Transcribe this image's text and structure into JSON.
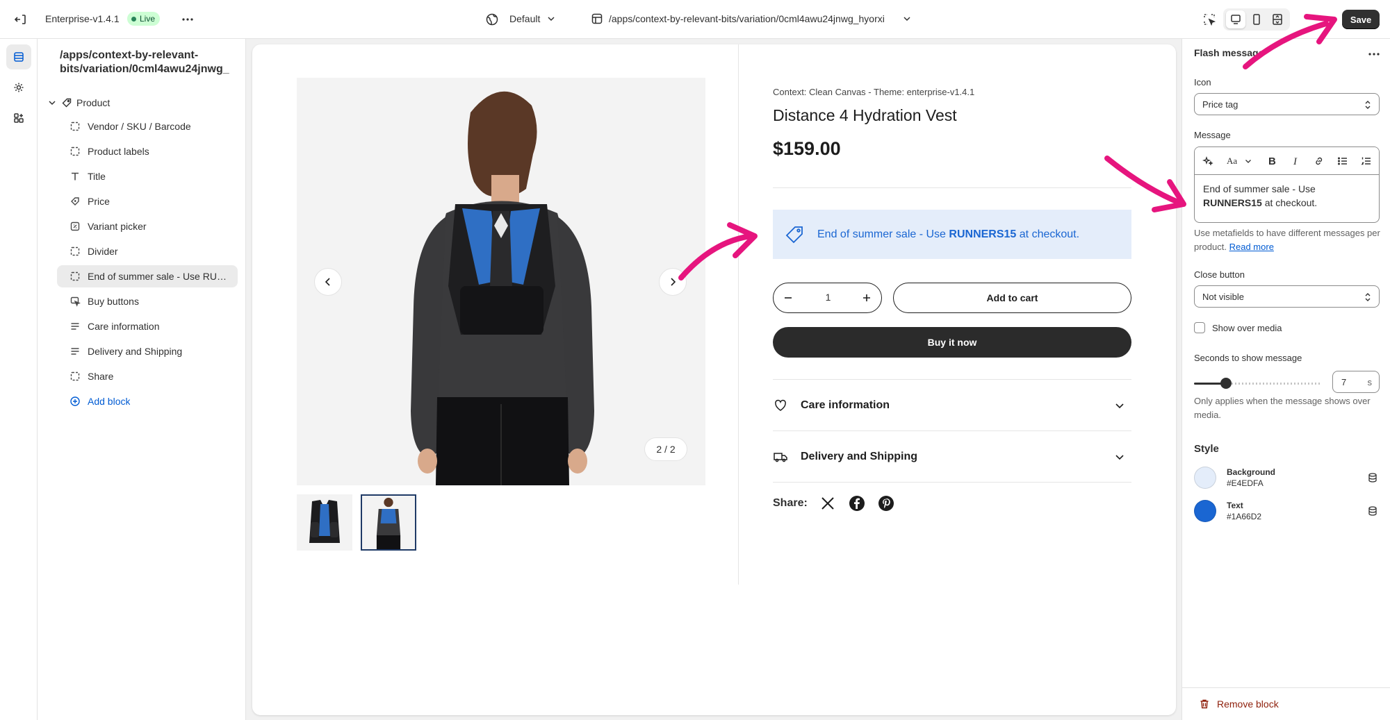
{
  "topbar": {
    "theme_name": "Enterprise-v1.4.1",
    "status_badge": "Live",
    "template": "Default",
    "page_path": "/apps/context-by-relevant-bits/variation/0cml4awu24jnwg_hyorxi",
    "save_label": "Save"
  },
  "sidebar": {
    "title_line1": "/apps/context-by-relevant-",
    "title_line2": "bits/variation/0cml4awu24jnwg_",
    "root_label": "Product",
    "items": [
      {
        "label": "Vendor / SKU / Barcode",
        "icon": "block-icon"
      },
      {
        "label": "Product labels",
        "icon": "block-icon"
      },
      {
        "label": "Title",
        "icon": "title-icon"
      },
      {
        "label": "Price",
        "icon": "price-icon"
      },
      {
        "label": "Variant picker",
        "icon": "variant-icon"
      },
      {
        "label": "Divider",
        "icon": "block-icon"
      },
      {
        "label": "End of summer sale - Use RUNNERS15 at checkout.",
        "icon": "block-icon"
      },
      {
        "label": "Buy buttons",
        "icon": "cursor-icon"
      },
      {
        "label": "Care information",
        "icon": "text-icon"
      },
      {
        "label": "Delivery and Shipping",
        "icon": "text-icon"
      },
      {
        "label": "Share",
        "icon": "block-icon"
      }
    ],
    "add_block": "Add block"
  },
  "preview": {
    "context_line": "Context: Clean Canvas - Theme: enterprise-v1.4.1",
    "product_title": "Distance 4 Hydration Vest",
    "price": "$159.00",
    "image_counter": "2 / 2",
    "flash": {
      "text_before": "End of summer sale - Use ",
      "code": "RUNNERS15",
      "text_after": " at checkout.",
      "background": "#E4EDFA",
      "text_color": "#1A66D2"
    },
    "quantity": "1",
    "add_to_cart": "Add to cart",
    "buy_now": "Buy it now",
    "accordions": [
      "Care information",
      "Delivery and Shipping"
    ],
    "share_label": "Share:"
  },
  "panel": {
    "title": "Flash message",
    "icon_label": "Icon",
    "icon_value": "Price tag",
    "message_label": "Message",
    "message_before": "End of summer sale - Use ",
    "message_code": "RUNNERS15",
    "message_after": " at checkout.",
    "message_help": "Use metafields to have different messages per product.",
    "read_more": "Read more",
    "close_button_label": "Close button",
    "close_button_value": "Not visible",
    "show_over_media": "Show over media",
    "seconds_label": "Seconds to show message",
    "seconds_value": "7",
    "seconds_unit": "s",
    "seconds_fraction": 0.25,
    "seconds_help": "Only applies when the message shows over media.",
    "style_label": "Style",
    "background_label": "Background",
    "background_hex": "#E4EDFA",
    "text_label": "Text",
    "text_hex": "#1A66D2",
    "remove_block": "Remove block"
  }
}
